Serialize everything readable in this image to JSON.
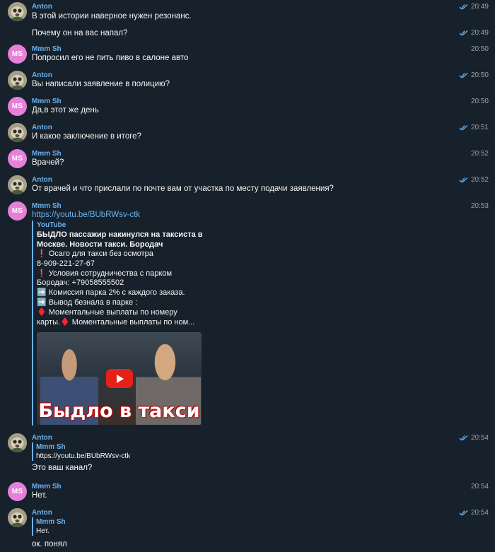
{
  "colors": {
    "background": "#17212b",
    "sender_name": "#6ab3f3",
    "link": "#6ab3f3",
    "text": "#f5f5f5",
    "time": "#9aa3ad",
    "ms_avatar": "#e680d8",
    "youtube_play": "#e62117"
  },
  "messages": [
    {
      "sender": "Anton",
      "text": "В этой истории наверное нужен резонанс.",
      "time": "20:49",
      "read": true
    },
    {
      "text": "Почему он на вас напал?",
      "time": "20:49",
      "read": true
    },
    {
      "sender": "Mmm Sh",
      "avatar_initials": "MS",
      "text": "Попросил его не пить пиво в салоне авто",
      "time": "20:50"
    },
    {
      "sender": "Anton",
      "text": "Вы написали заявление в полицию?",
      "time": "20:50",
      "read": true
    },
    {
      "sender": "Mmm Sh",
      "avatar_initials": "MS",
      "text": "Да,в этот же день",
      "time": "20:50"
    },
    {
      "sender": "Anton",
      "text": "И какое заключение в итоге?",
      "time": "20:51",
      "read": true
    },
    {
      "sender": "Mmm Sh",
      "avatar_initials": "MS",
      "text": "Врачей?",
      "time": "20:52"
    },
    {
      "sender": "Anton",
      "text": "От врачей и что прислали по почте вам от участка по месту подачи заявления?",
      "time": "20:52",
      "read": true
    },
    {
      "sender": "Mmm Sh",
      "avatar_initials": "MS",
      "text": "https://youtu.be/BUbRWsv-ctk",
      "time": "20:53",
      "preview": {
        "site": "YouTube",
        "title_lines": [
          "БЫДЛО пассажир накинулся на таксиста в",
          "Москве. Новости такси. Бородач"
        ],
        "description_lines": [
          "❗ Осаго для такси  без осмотра",
          "8-909-221-27-67",
          "❗  Условия сотрудничества с парком",
          "Бородач: +79058555502",
          "➡️ Комиссия парка 2% с каждого заказа.",
          "➡️ Вывод безнала в парке :",
          "♦️ Моментальные выплаты  по номеру",
          "карты.♦️ Моментальные выплаты по ном..."
        ],
        "thumbnail_caption": "Быдло в такси"
      }
    },
    {
      "sender": "Anton",
      "quote_name": "Mmm Sh",
      "quote_text": "https://youtu.be/BUbRWsv-ctk",
      "text": "Это ваш канал?",
      "time": "20:54",
      "read": true
    },
    {
      "sender": "Mmm Sh",
      "avatar_initials": "MS",
      "text": "Нет.",
      "time": "20:54"
    },
    {
      "sender": "Anton",
      "quote_name": "Mmm Sh",
      "quote_text": "Нет.",
      "text": "ок. понял",
      "time": "20:54",
      "read": true
    }
  ]
}
